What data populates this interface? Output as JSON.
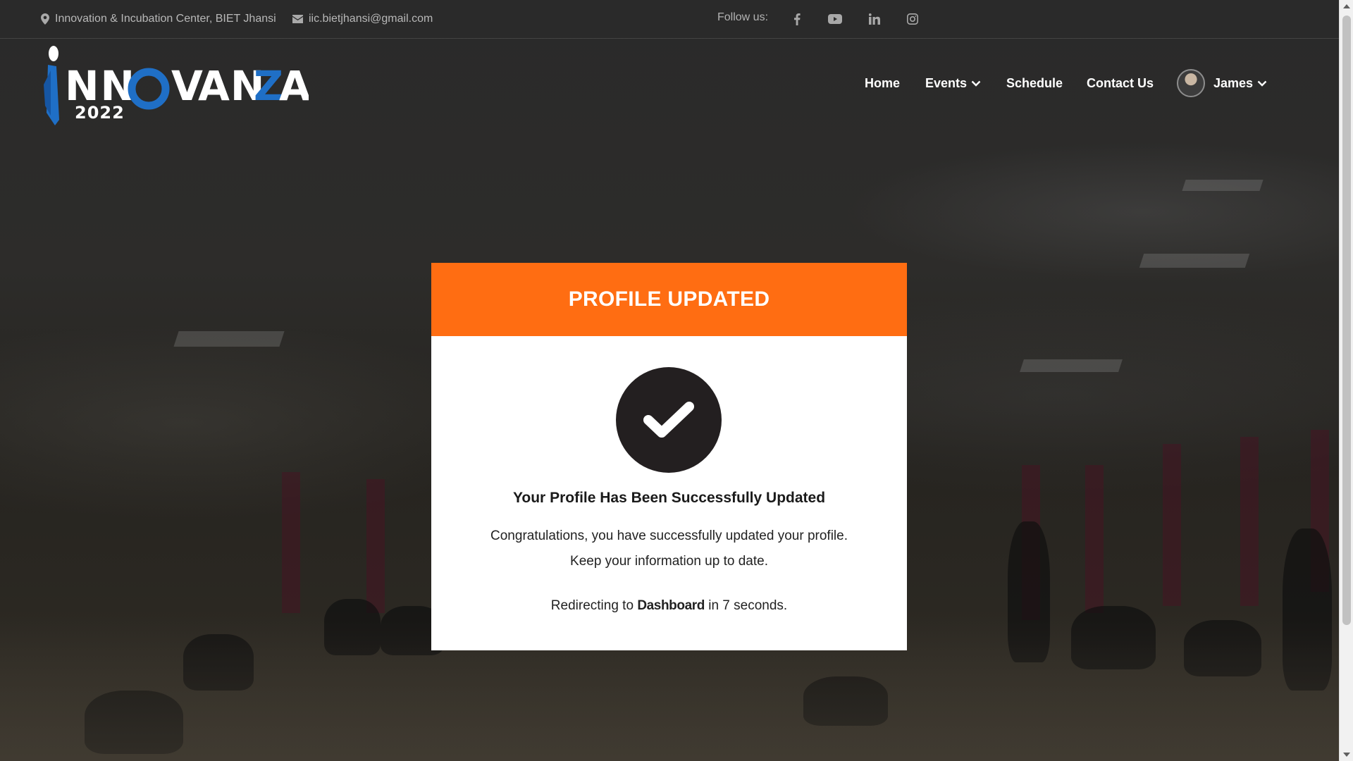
{
  "topbar": {
    "location": "Innovation & Incubation Center, BIET Jhansi",
    "email": "iic.bietjhansi@gmail.com",
    "follow_label": "Follow us:",
    "socials": [
      "facebook-icon",
      "youtube-icon",
      "linkedin-icon",
      "instagram-icon"
    ]
  },
  "brand": {
    "name": "NNOVANZA",
    "year": "2022",
    "colors": {
      "blue": "#1f6fc6",
      "white": "#ffffff"
    }
  },
  "nav": {
    "home": "Home",
    "events": "Events",
    "schedule": "Schedule",
    "contact": "Contact Us",
    "user": "James"
  },
  "modal": {
    "header": "PROFILE UPDATED",
    "heading": "Your Profile Has Been Successfully Updated",
    "line1": "Congratulations, you have successfully updated your profile.",
    "line2": "Keep your information up to date.",
    "redirect_prefix": "Redirecting to",
    "redirect_target": "Dashboard",
    "redirect_suffix": "in 7 seconds.",
    "accent_color": "#ff6d12"
  }
}
